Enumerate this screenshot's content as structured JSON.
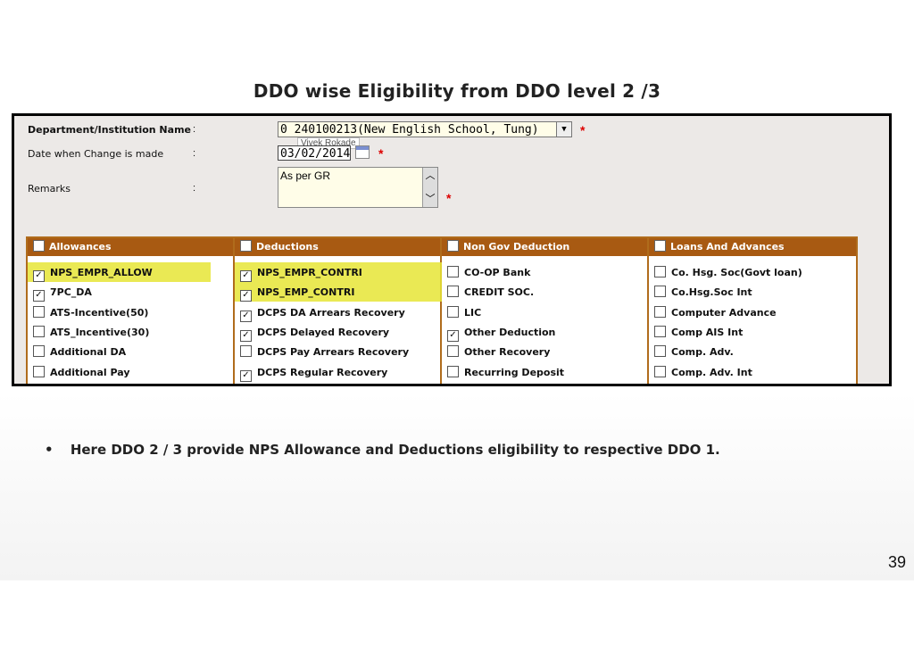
{
  "slide": {
    "title": "DDO wise Eligibility from DDO level 2 /3",
    "bullet_text": "Here DDO 2 / 3 provide NPS Allowance and Deductions eligibility to respective DDO 1.",
    "bullet_mark": "•",
    "page_number": "39"
  },
  "form": {
    "department_label": "Department/Institution Name",
    "department_value": "0 240100213(New English School, Tung)",
    "date_label": "Date when Change is made",
    "date_value": "03/02/2014",
    "remarks_label": "Remarks",
    "remarks_value": "As per GR",
    "colon": ":",
    "required_mark": "*",
    "tooltip": "Vivek Rokade"
  },
  "grid": {
    "headers": [
      "Allowances",
      "Deductions",
      "Non Gov Deduction",
      "Loans And Advances"
    ],
    "columns": [
      [
        {
          "label": "NPS_EMPR_ALLOW",
          "checked": true,
          "highlight": true
        },
        {
          "label": "7PC_DA",
          "checked": true,
          "highlight": false
        },
        {
          "label": "ATS-Incentive(50)",
          "checked": false,
          "highlight": false
        },
        {
          "label": "ATS_Incentive(30)",
          "checked": false,
          "highlight": false
        },
        {
          "label": "Additional DA",
          "checked": false,
          "highlight": false
        },
        {
          "label": "Additional Pay",
          "checked": false,
          "highlight": false
        }
      ],
      [
        {
          "label": "NPS_EMPR_CONTRI",
          "checked": true,
          "highlight": true
        },
        {
          "label": "NPS_EMP_CONTRI",
          "checked": true,
          "highlight": true
        },
        {
          "label": "DCPS DA Arrears Recovery",
          "checked": true,
          "highlight": false
        },
        {
          "label": "DCPS Delayed Recovery",
          "checked": true,
          "highlight": false
        },
        {
          "label": "DCPS Pay Arrears Recovery",
          "checked": false,
          "highlight": false
        },
        {
          "label": "DCPS Regular Recovery",
          "checked": true,
          "highlight": false
        }
      ],
      [
        {
          "label": "CO-OP Bank",
          "checked": false,
          "highlight": false
        },
        {
          "label": "CREDIT SOC.",
          "checked": false,
          "highlight": false
        },
        {
          "label": "LIC",
          "checked": false,
          "highlight": false
        },
        {
          "label": "Other Deduction",
          "checked": true,
          "highlight": false
        },
        {
          "label": "Other Recovery",
          "checked": false,
          "highlight": false
        },
        {
          "label": "Recurring Deposit",
          "checked": false,
          "highlight": false
        }
      ],
      [
        {
          "label": "Co. Hsg. Soc(Govt loan)",
          "checked": false,
          "highlight": false
        },
        {
          "label": "Co.Hsg.Soc Int",
          "checked": false,
          "highlight": false
        },
        {
          "label": "Computer Advance",
          "checked": false,
          "highlight": false
        },
        {
          "label": "Comp AIS Int",
          "checked": false,
          "highlight": false
        },
        {
          "label": "Comp. Adv.",
          "checked": false,
          "highlight": false
        },
        {
          "label": "Comp. Adv. Int",
          "checked": false,
          "highlight": false
        }
      ]
    ],
    "check_glyph": "✓",
    "highlight_color": "#e6e536",
    "header_color": "#a85a12"
  }
}
